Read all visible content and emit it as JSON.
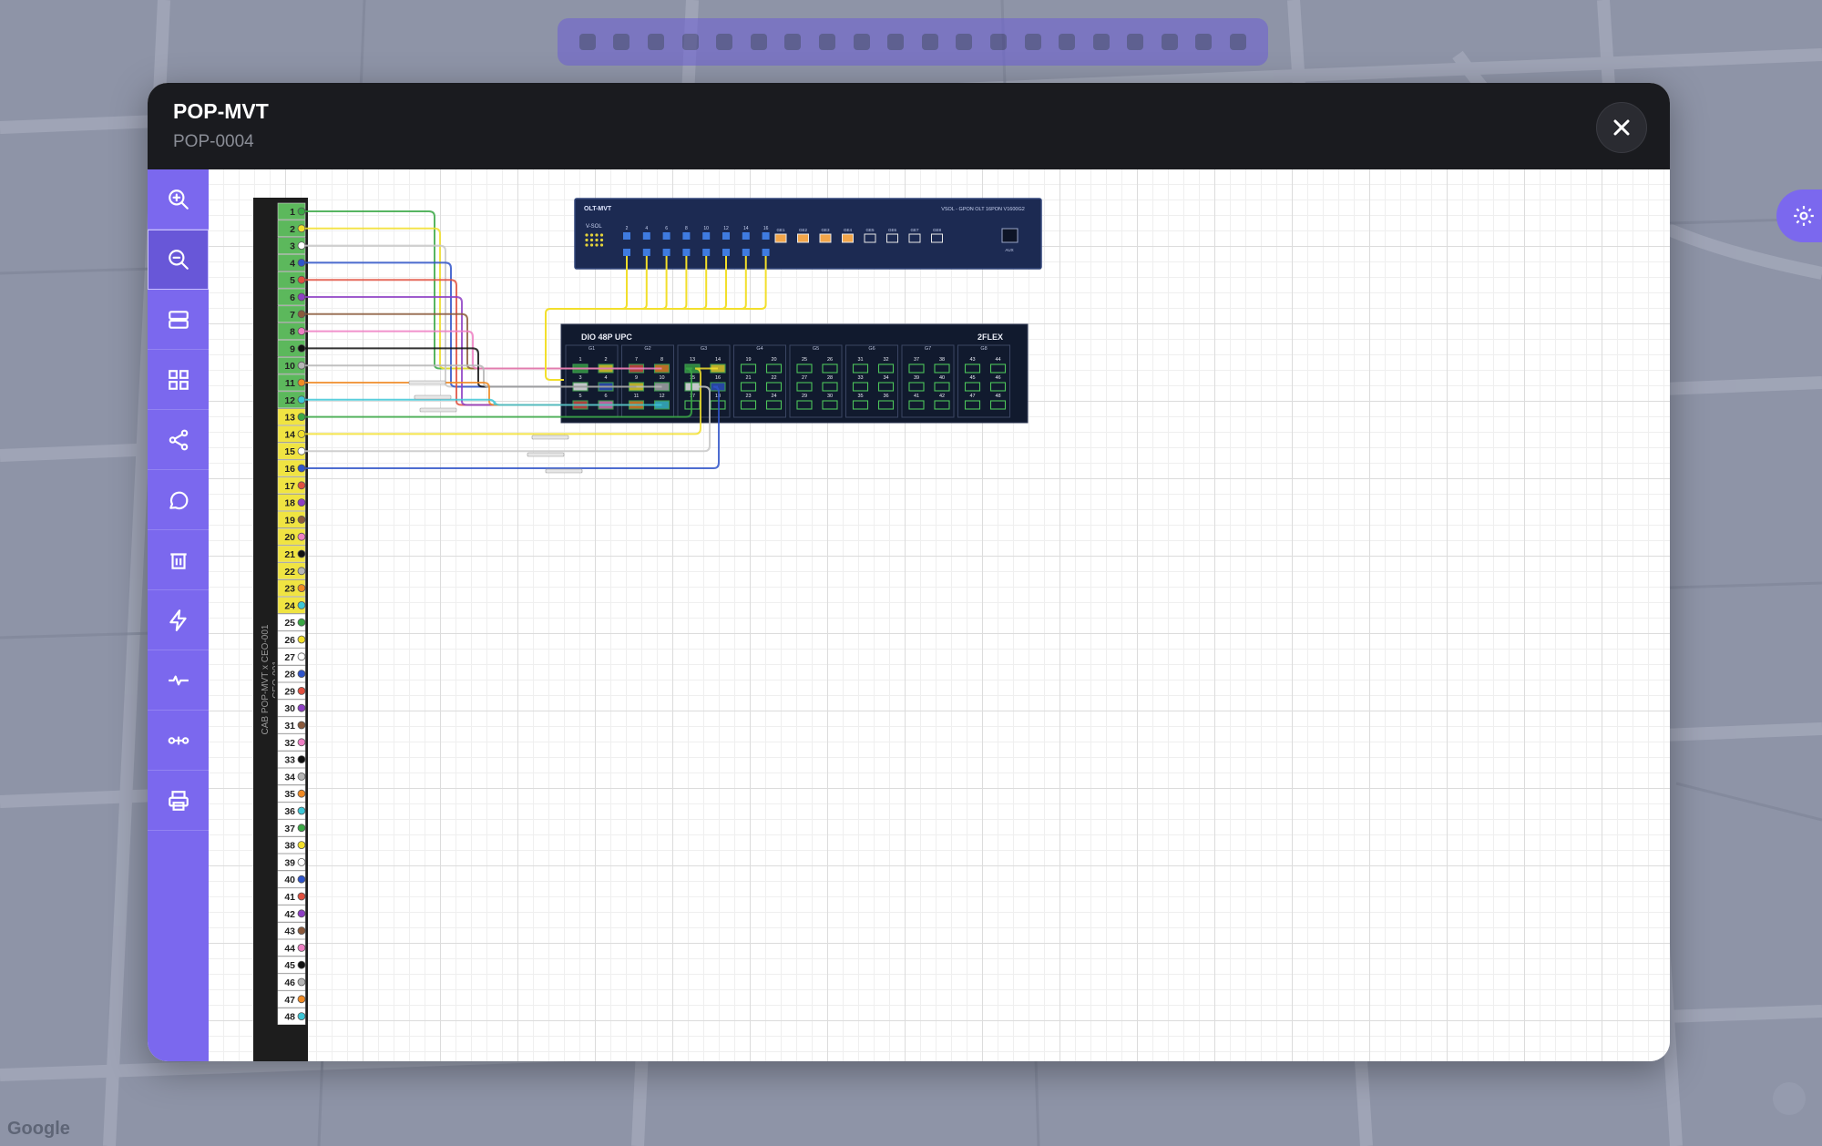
{
  "modal": {
    "title": "POP-MVT",
    "subtitle": "POP-0004"
  },
  "sidebar": {
    "items": [
      {
        "name": "zoom-in-icon"
      },
      {
        "name": "zoom-out-icon",
        "active": true
      },
      {
        "name": "server-icon"
      },
      {
        "name": "grid-icon"
      },
      {
        "name": "share-icon"
      },
      {
        "name": "comment-icon"
      },
      {
        "name": "trash-icon"
      },
      {
        "name": "lightning-icon"
      },
      {
        "name": "pulse-icon"
      },
      {
        "name": "fusion-icon"
      },
      {
        "name": "printer-icon"
      }
    ]
  },
  "cable": {
    "label": "CAB POP-MVT x CEO-001",
    "label2": "CEO-001",
    "fibers": 48,
    "tube_colors": [
      "#5cb85c",
      "#f0e442"
    ],
    "fiber_colors": [
      "#3aa845",
      "#f2df2b",
      "#ffffff",
      "#2f54c9",
      "#e05040",
      "#8e3fc4",
      "#8b5a3c",
      "#ee7fc3",
      "#111111",
      "#b5b5b5",
      "#f08a24",
      "#3cc6d6"
    ]
  },
  "olt": {
    "name": "OLT-MVT",
    "model": "VSOL - GPON OLT 16PON V1600G2",
    "brand": "V-SOL",
    "pon_ports": [
      "2",
      "4",
      "6",
      "8",
      "10",
      "12",
      "14",
      "16"
    ],
    "uplinks": [
      "GE1",
      "GE2",
      "GE3",
      "GE4",
      "GE5",
      "GE6",
      "GE7",
      "GE8"
    ],
    "aux_label": "AUX"
  },
  "dio": {
    "name": "DIO 48P UPC",
    "brand": "2FLEX",
    "groups": [
      {
        "label": "G1",
        "ports": [
          "1",
          "2",
          "3",
          "4",
          "5",
          "6"
        ]
      },
      {
        "label": "G2",
        "ports": [
          "7",
          "8",
          "9",
          "10",
          "11",
          "12"
        ]
      },
      {
        "label": "G3",
        "ports": [
          "13",
          "14",
          "15",
          "16",
          "17",
          "18"
        ]
      },
      {
        "label": "G4",
        "ports": [
          "19",
          "20",
          "21",
          "22",
          "23",
          "24"
        ]
      },
      {
        "label": "G5",
        "ports": [
          "25",
          "26",
          "27",
          "28",
          "29",
          "30"
        ]
      },
      {
        "label": "G6",
        "ports": [
          "31",
          "32",
          "33",
          "34",
          "35",
          "36"
        ]
      },
      {
        "label": "G7",
        "ports": [
          "37",
          "38",
          "39",
          "40",
          "41",
          "42"
        ]
      },
      {
        "label": "G8",
        "ports": [
          "43",
          "44",
          "45",
          "46",
          "47",
          "48"
        ]
      }
    ]
  },
  "colors": {
    "accent": "#7b68ee",
    "header_bg": "#1a1b1f",
    "olt_bg": "#1c2a52",
    "dio_bg": "#111a2e"
  }
}
